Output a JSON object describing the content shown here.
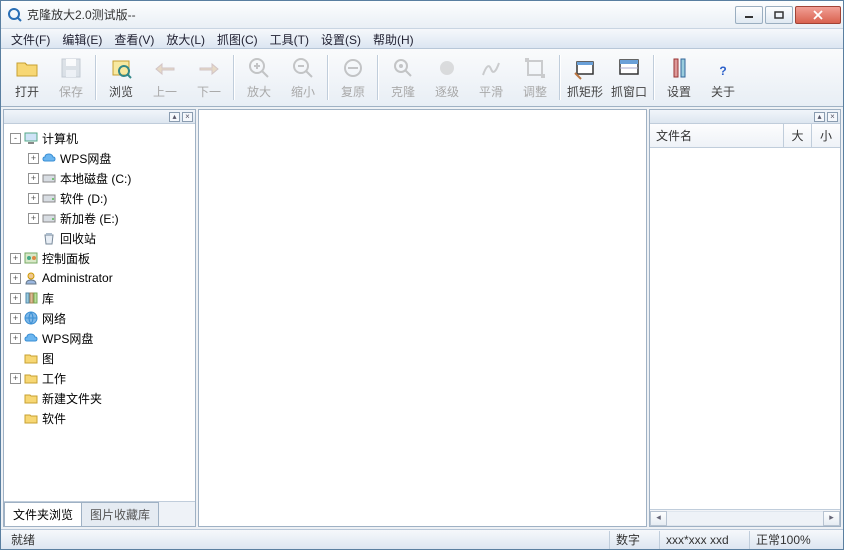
{
  "title": "克隆放大2.0测试版--",
  "menu": [
    "文件(F)",
    "编辑(E)",
    "查看(V)",
    "放大(L)",
    "抓图(C)",
    "工具(T)",
    "设置(S)",
    "帮助(H)"
  ],
  "toolbar": [
    {
      "label": "打开",
      "icon": "folder",
      "enabled": true
    },
    {
      "label": "保存",
      "icon": "save",
      "enabled": false
    },
    {
      "sep": true
    },
    {
      "label": "浏览",
      "icon": "browse",
      "enabled": true
    },
    {
      "label": "上一",
      "icon": "hand-left",
      "enabled": false
    },
    {
      "label": "下一",
      "icon": "hand-right",
      "enabled": false
    },
    {
      "sep": true
    },
    {
      "label": "放大",
      "icon": "zoom-in",
      "enabled": false
    },
    {
      "label": "缩小",
      "icon": "zoom-out",
      "enabled": false
    },
    {
      "sep": true
    },
    {
      "label": "复原",
      "icon": "restore",
      "enabled": false
    },
    {
      "sep": true
    },
    {
      "label": "克隆",
      "icon": "clone",
      "enabled": false
    },
    {
      "label": "逐级",
      "icon": "step",
      "enabled": false
    },
    {
      "label": "平滑",
      "icon": "smooth",
      "enabled": false
    },
    {
      "label": "调整",
      "icon": "adjust",
      "enabled": false
    },
    {
      "sep": true
    },
    {
      "label": "抓矩形",
      "icon": "capture-rect",
      "enabled": true
    },
    {
      "label": "抓窗口",
      "icon": "capture-win",
      "enabled": true
    },
    {
      "sep": true
    },
    {
      "label": "设置",
      "icon": "settings",
      "enabled": true
    },
    {
      "label": "关于",
      "icon": "about",
      "enabled": true
    }
  ],
  "tree": [
    {
      "d": 0,
      "exp": "-",
      "icon": "computer",
      "label": "计算机"
    },
    {
      "d": 1,
      "exp": "+",
      "icon": "cloud",
      "label": "WPS网盘"
    },
    {
      "d": 1,
      "exp": "+",
      "icon": "drive",
      "label": "本地磁盘 (C:)"
    },
    {
      "d": 1,
      "exp": "+",
      "icon": "drive",
      "label": "软件 (D:)"
    },
    {
      "d": 1,
      "exp": "+",
      "icon": "drive",
      "label": "新加卷 (E:)"
    },
    {
      "d": 1,
      "exp": "",
      "icon": "recycle",
      "label": "回收站"
    },
    {
      "d": 0,
      "exp": "+",
      "icon": "control",
      "label": "控制面板"
    },
    {
      "d": 0,
      "exp": "+",
      "icon": "user",
      "label": "Administrator"
    },
    {
      "d": 0,
      "exp": "+",
      "icon": "library",
      "label": "库"
    },
    {
      "d": 0,
      "exp": "+",
      "icon": "network",
      "label": "网络"
    },
    {
      "d": 0,
      "exp": "+",
      "icon": "cloud",
      "label": "WPS网盘"
    },
    {
      "d": 0,
      "exp": "",
      "icon": "folder-y",
      "label": "图"
    },
    {
      "d": 0,
      "exp": "+",
      "icon": "folder-y",
      "label": "工作"
    },
    {
      "d": 0,
      "exp": "",
      "icon": "folder-y",
      "label": "新建文件夹"
    },
    {
      "d": 0,
      "exp": "",
      "icon": "folder-y",
      "label": "软件"
    }
  ],
  "left_tabs": {
    "active": "文件夹浏览",
    "inactive": "图片收藏库"
  },
  "right_cols": {
    "name": "文件名",
    "size1": "大",
    "size2": "小"
  },
  "status": {
    "ready": "就绪",
    "num": "数字",
    "dim": "xxx*xxx xxd",
    "zoom": "正常100%"
  }
}
